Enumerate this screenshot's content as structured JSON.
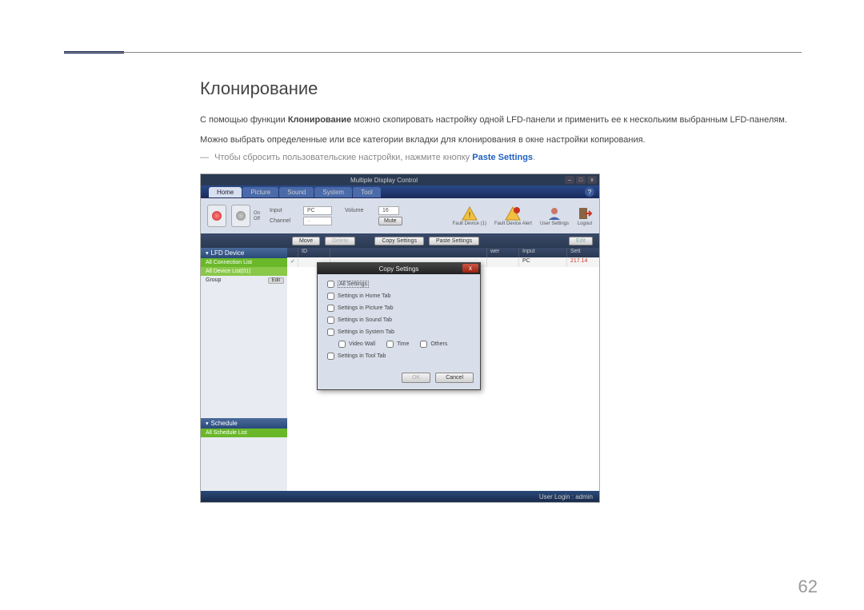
{
  "doc": {
    "heading": "Клонирование",
    "para1_pre": "С помощью функции ",
    "para1_bold": "Клонирование",
    "para1_post": " можно скопировать настройку одной LFD-панели и применить ее к нескольким выбранным LFD-панелям.",
    "para2": "Можно выбрать определенные или все категории вкладки для клонирования в окне настройки копирования.",
    "note_dash": "―",
    "note_text": "Чтобы сбросить пользовательские настройки, нажмите кнопку ",
    "note_link": "Paste Settings",
    "page_number": "62"
  },
  "ss": {
    "window_title": "Multiple Display Control",
    "win_min": "–",
    "win_max": "□",
    "win_close": "x",
    "tabs": [
      "Home",
      "Picture",
      "Sound",
      "System",
      "Tool"
    ],
    "help": "?",
    "on_label": "On",
    "off_label": "Off",
    "input_label": "Input",
    "input_val": "PC",
    "channel_label": "Channel",
    "volume_label": "Volume",
    "volume_val": "16",
    "mute_label": "Mute",
    "ticons": [
      "Fault Device (1)",
      "Fault Device Alert",
      "User Settings",
      "Logout"
    ],
    "btnrow": {
      "move": "Move",
      "delete": "Delete",
      "copy": "Copy Settings",
      "paste": "Paste Settings",
      "edit": "Edit"
    },
    "side": {
      "lfd": "LFD Device",
      "all_conn": "All Connection List",
      "all_dev": "All Device List(01)",
      "group": "Group",
      "schedule": "Schedule",
      "all_sched": "All Schedule List"
    },
    "grid": {
      "cols": [
        "",
        "ID",
        "wer",
        "Input",
        "Sett"
      ],
      "row": {
        "id": "",
        "pwr": "",
        "input": "PC",
        "sett": "217.14"
      }
    },
    "dialog": {
      "title": "Copy Settings",
      "close": "x",
      "all": "All Settings",
      "home": "Settings in Home Tab",
      "picture": "Settings in Picture Tab",
      "sound": "Settings in Sound Tab",
      "system": "Settings in System Tab",
      "vw": "Video Wall",
      "time": "Time",
      "others": "Others",
      "tool": "Settings in Tool Tab",
      "ok": "OK",
      "cancel": "Cancel"
    },
    "status": "User Login : admin"
  }
}
